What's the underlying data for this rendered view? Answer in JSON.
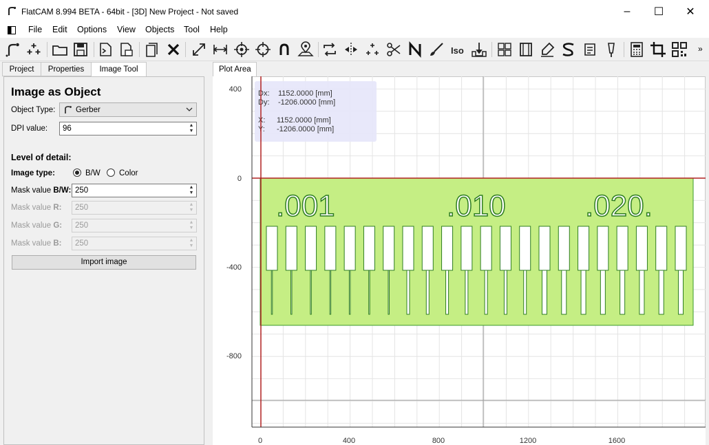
{
  "window": {
    "title": "FlatCAM 8.994 BETA - 64bit - [3D]   New Project - Not saved",
    "minimize": "–",
    "maximize": "☐",
    "close": "✕"
  },
  "menu": [
    "File",
    "Edit",
    "Options",
    "View",
    "Objects",
    "Tool",
    "Help"
  ],
  "toolbar": {
    "overflow": "»"
  },
  "left_tabs": [
    "Project",
    "Properties",
    "Image Tool"
  ],
  "image_tool": {
    "title": "Image as Object",
    "object_type_label": "Object Type:",
    "object_type_value": "Gerber",
    "dpi_label": "DPI value:",
    "dpi_value": "96",
    "level_label": "Level of detail:",
    "image_type_label": "Image type:",
    "image_type_bw": "B/W",
    "image_type_color": "Color",
    "image_type_selected": "B/W",
    "mask_bw_prefix": "Mask value ",
    "mask_bw_suffix": "B/W:",
    "mask_bw_value": "250",
    "mask_r_prefix": "Mask value ",
    "mask_r_suffix": "R:",
    "mask_r_value": "250",
    "mask_g_prefix": "Mask value ",
    "mask_g_suffix": "G:",
    "mask_g_value": "250",
    "mask_b_prefix": "Mask value ",
    "mask_b_suffix": "B:",
    "mask_b_value": "250",
    "import_button": "Import image"
  },
  "plot": {
    "tab_label": "Plot Area",
    "hud": {
      "dx_label": "Dx:",
      "dx_value": "1152.0000 [mm]",
      "dy_label": "Dy:",
      "dy_value": "-1206.0000 [mm]",
      "x_label": "X:",
      "x_value": "1152.0000 [mm]",
      "y_label": "Y:",
      "y_value": "-1206.0000 [mm]"
    },
    "y_ticks": [
      "400",
      "0",
      "-400",
      "-800"
    ],
    "x_ticks": [
      "0",
      "400",
      "800",
      "1200",
      "1600"
    ],
    "gerber_labels": [
      ".001",
      ".010",
      ".020."
    ],
    "colors": {
      "gerber_fill": "#c5ee84",
      "gerber_stroke": "#3a9a2a",
      "axis_red": "#b02020",
      "hud_bg": "#e6e6fa",
      "grid": "#e0e0e0"
    }
  }
}
